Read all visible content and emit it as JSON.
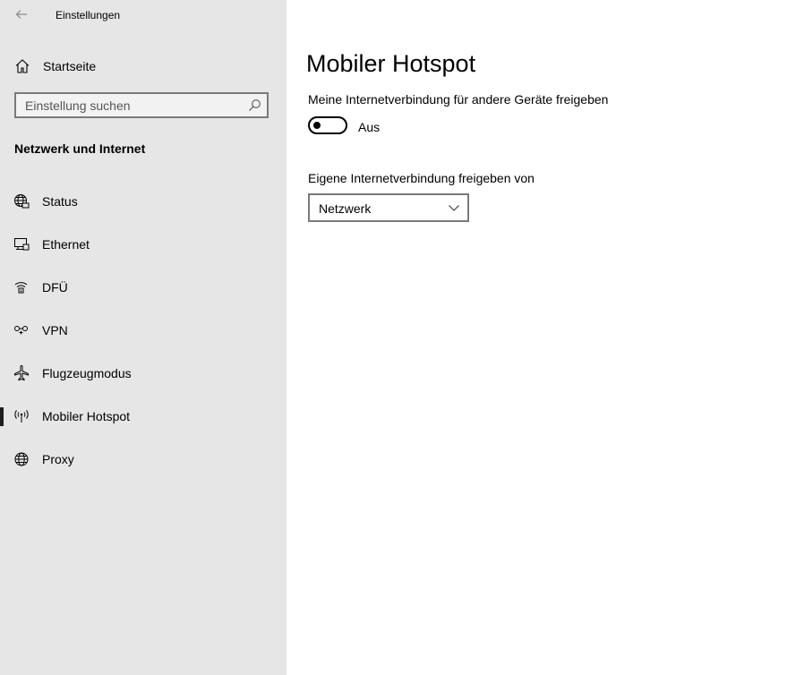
{
  "window": {
    "title": "Einstellungen",
    "back_icon": "arrow-left-icon"
  },
  "sidebar": {
    "home": {
      "label": "Startseite",
      "icon": "home-icon"
    },
    "search": {
      "placeholder": "Einstellung suchen",
      "value": "",
      "icon": "search-icon"
    },
    "section_title": "Netzwerk und Internet",
    "items": [
      {
        "label": "Status",
        "icon": "globe-status-icon"
      },
      {
        "label": "Ethernet",
        "icon": "ethernet-icon"
      },
      {
        "label": "DFÜ",
        "icon": "dialup-icon"
      },
      {
        "label": "VPN",
        "icon": "vpn-icon"
      },
      {
        "label": "Flugzeugmodus",
        "icon": "airplane-icon"
      },
      {
        "label": "Mobiler Hotspot",
        "icon": "hotspot-icon",
        "active": true
      },
      {
        "label": "Proxy",
        "icon": "globe-icon"
      }
    ]
  },
  "main": {
    "title": "Mobiler Hotspot",
    "share_label": "Meine Internetverbindung für andere Geräte freigeben",
    "toggle": {
      "state_label": "Aus",
      "on": false
    },
    "share_from_label": "Eigene Internetverbindung freigeben von",
    "dropdown": {
      "selected": "Netzwerk",
      "icon": "chevron-down-icon"
    }
  },
  "colors": {
    "sidebar_bg": "#e6e6e6",
    "content_bg": "#ffffff",
    "border": "#7a7a7a",
    "active_indicator": "#1f1f1f"
  }
}
